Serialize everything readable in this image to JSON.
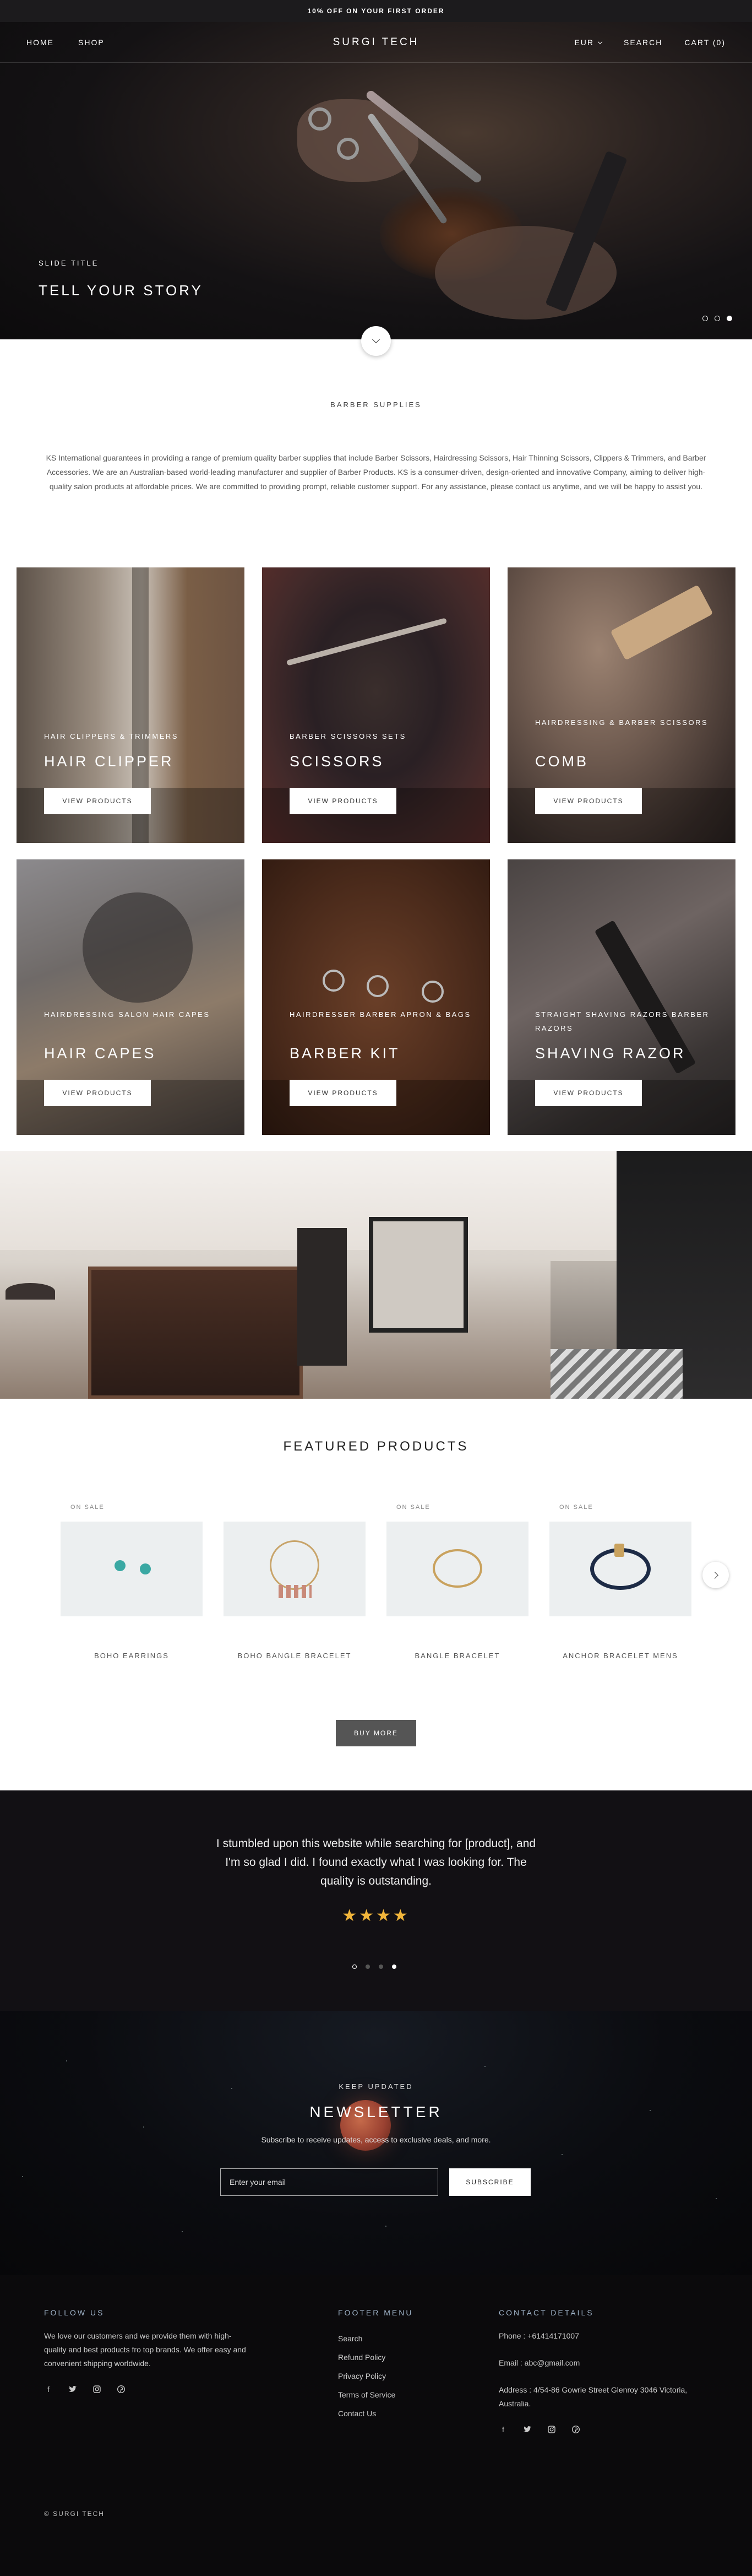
{
  "announcement": "10% OFF ON YOUR FIRST ORDER",
  "nav": {
    "home": "HOME",
    "shop": "SHOP",
    "brand": "SURGI TECH",
    "currency": "EUR",
    "search": "SEARCH",
    "cart": "CART (0)"
  },
  "hero": {
    "subtitle": "SLIDE TITLE",
    "title": "TELL YOUR STORY",
    "slides": 3,
    "active_slide": 3
  },
  "intro": {
    "title": "BARBER SUPPLIES",
    "text": "KS International guarantees in providing a range of premium quality barber supplies that include Barber Scissors, Hairdressing Scissors, Hair Thinning Scissors, Clippers & Trimmers, and Barber Accessories. We are an Australian-based world-leading manufacturer and supplier of Barber Products. KS is a consumer-driven, design-oriented and innovative Company, aiming to deliver high-quality salon products at affordable prices. We are committed to providing prompt, reliable customer support. For any assistance, please contact us anytime, and we will be happy to assist you."
  },
  "categories": [
    {
      "subtitle": "HAIR CLIPPERS & TRIMMERS",
      "title": "HAIR CLIPPER",
      "button": "VIEW PRODUCTS"
    },
    {
      "subtitle": "BARBER SCISSORS SETS",
      "title": "SCISSORS",
      "button": "VIEW PRODUCTS"
    },
    {
      "subtitle": "HAIRDRESSING & BARBER SCISSORS",
      "title": "COMB",
      "button": "VIEW PRODUCTS"
    },
    {
      "subtitle": "HAIRDRESSING SALON HAIR CAPES",
      "title": "HAIR CAPES",
      "button": "VIEW PRODUCTS"
    },
    {
      "subtitle": "HAIRDRESSER BARBER APRON & BAGS",
      "title": "BARBER KIT",
      "button": "VIEW PRODUCTS"
    },
    {
      "subtitle": "STRAIGHT SHAVING RAZORS BARBER RAZORS",
      "title": "SHAVING RAZOR",
      "button": "VIEW PRODUCTS"
    }
  ],
  "featured": {
    "title": "FEATURED PRODUCTS",
    "products": [
      {
        "badge": "ON SALE",
        "name": "BOHO EARRINGS"
      },
      {
        "badge": "",
        "name": "BOHO BANGLE BRACELET"
      },
      {
        "badge": "ON SALE",
        "name": "BANGLE BRACELET"
      },
      {
        "badge": "ON SALE",
        "name": "ANCHOR BRACELET MENS"
      }
    ],
    "button": "BUY MORE"
  },
  "testimonial": {
    "quote": "I stumbled upon this website while searching for [product], and I'm so glad I did. I found exactly what I was looking for. The quality is outstanding.",
    "stars": "★★★★",
    "rating": 4,
    "active_dot": 4
  },
  "newsletter": {
    "kicker": "KEEP UPDATED",
    "title": "NEWSLETTER",
    "text": "Subscribe to receive updates, access to exclusive deals, and more.",
    "placeholder": "Enter your email",
    "button": "SUBSCRIBE"
  },
  "footer": {
    "follow_title": "FOLLOW US",
    "follow_text": "We love our customers and we provide them with high-quality and best products fro top brands. We offer easy and convenient shipping worldwide.",
    "menu_title": "FOOTER MENU",
    "menu": [
      "Search",
      "Refund Policy",
      "Privacy Policy",
      "Terms of Service",
      "Contact Us"
    ],
    "contact_title": "CONTACT DETAILS",
    "phone": "Phone : +61414171007",
    "email": "Email : abc@gmail.com",
    "address": "Address : 4/54-86 Gowrie Street Glenroy 3046 Victoria, Australia.",
    "social_icons": [
      "facebook-icon",
      "twitter-icon",
      "instagram-icon",
      "pinterest-icon"
    ],
    "copyright": "© SURGI TECH"
  },
  "colors": {
    "announcement_bg": "#1c1b1d",
    "star": "#f2b63b",
    "footer_heading": "#9fb3c8",
    "buy_more_bg": "#555555"
  }
}
